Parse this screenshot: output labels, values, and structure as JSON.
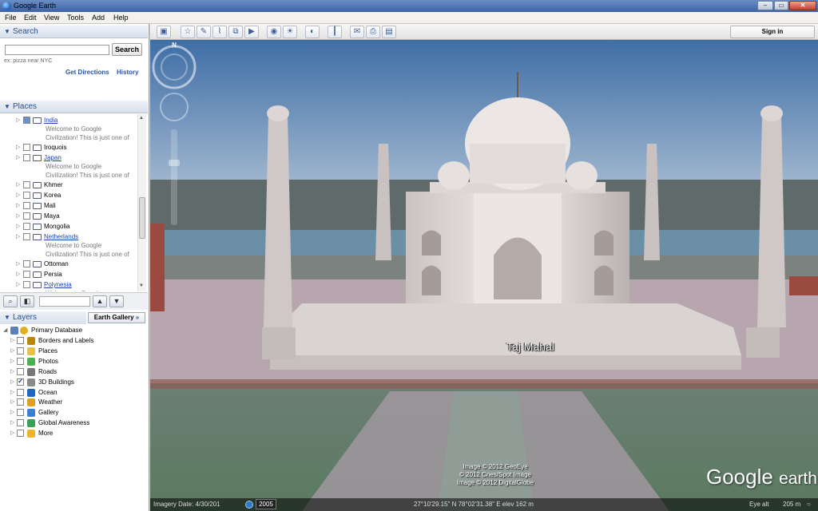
{
  "window": {
    "title": "Google Earth",
    "min": "–",
    "max": "▭",
    "close": "✕"
  },
  "menu": [
    "File",
    "Edit",
    "View",
    "Tools",
    "Add",
    "Help"
  ],
  "search": {
    "header": "Search",
    "input_value": "",
    "button": "Search",
    "hint": "ex: pizza near NYC",
    "get_directions": "Get Directions",
    "history": "History"
  },
  "places": {
    "header": "Places",
    "items": [
      {
        "label": "India",
        "link": true,
        "checked": true,
        "desc": [
          "Welcome to Google",
          "Civilization! This is just one of"
        ]
      },
      {
        "label": "Iroquois",
        "link": false
      },
      {
        "label": "Japan",
        "link": true,
        "desc": [
          "Welcome to Google",
          "Civilization! This is just one of"
        ]
      },
      {
        "label": "Khmer",
        "link": false
      },
      {
        "label": "Korea",
        "link": false
      },
      {
        "label": "Mali",
        "link": false
      },
      {
        "label": "Maya",
        "link": false
      },
      {
        "label": "Mongolia",
        "link": false
      },
      {
        "label": "Netherlands",
        "link": true,
        "desc": [
          "Welcome to Google",
          "Civilization! This is just one of"
        ]
      },
      {
        "label": "Ottoman",
        "link": false
      },
      {
        "label": "Persia",
        "link": false
      },
      {
        "label": "Polynesia",
        "link": true,
        "desc": [
          "Welcome to Google"
        ]
      }
    ]
  },
  "layers": {
    "header": "Layers",
    "gallery_button": "Earth Gallery",
    "gallery_arrow": "»",
    "root": "Primary Database",
    "items": [
      {
        "label": "Borders and Labels",
        "checked": false,
        "icon": "#b8860b"
      },
      {
        "label": "Places",
        "checked": false,
        "icon": "#e3c34a"
      },
      {
        "label": "Photos",
        "checked": false,
        "icon": "#4caf50"
      },
      {
        "label": "Roads",
        "checked": false,
        "icon": "#777777"
      },
      {
        "label": "3D Buildings",
        "checked": true,
        "icon": "#8a8a8a"
      },
      {
        "label": "Ocean",
        "checked": false,
        "icon": "#1e66c2"
      },
      {
        "label": "Weather",
        "checked": false,
        "icon": "#e0a020"
      },
      {
        "label": "Gallery",
        "checked": false,
        "icon": "#3a7fd1"
      },
      {
        "label": "Global Awareness",
        "checked": false,
        "icon": "#3aa055"
      },
      {
        "label": "More",
        "checked": false,
        "icon": "#f0b429"
      }
    ]
  },
  "toolbar": {
    "buttons": [
      "sidebar",
      "placemark",
      "polygon",
      "path",
      "image-overlay",
      "tour",
      "historical-imagery",
      "sun",
      "planets",
      "ruler",
      "email",
      "print",
      "view-in-maps"
    ],
    "signin": "Sign in"
  },
  "viewport": {
    "place_label": "Taj Mahal",
    "copyright": [
      "Image © 2012 GeoEye",
      "© 2012 Cnes/Spot Image",
      "Image © 2012 DigitalGlobe"
    ],
    "logo_google": "Google",
    "logo_earth": "earth",
    "compass_n": "N"
  },
  "status": {
    "imagery_date": "Imagery Date: 4/30/201",
    "year": "2005",
    "coords": "27°10'29.15\" N  78°02'31.38\" E  elev  162 m",
    "eye_alt": "Eye alt",
    "eye_alt_value": "205 m"
  },
  "colors": {
    "accent": "#2a4f8f",
    "link": "#1a3fb8",
    "sky": "#5d8cbf"
  }
}
